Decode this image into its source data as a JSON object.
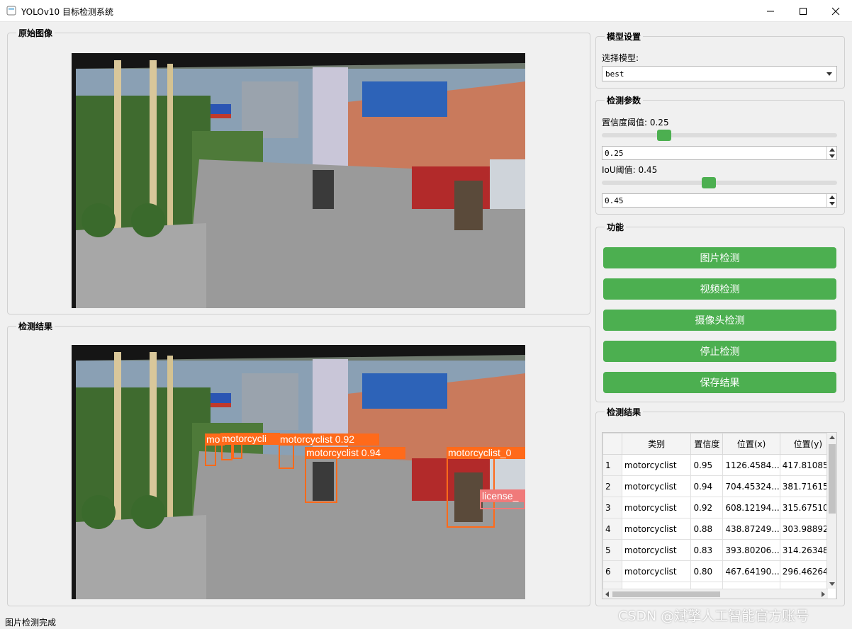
{
  "window": {
    "title": "YOLOv10 目标检测系统"
  },
  "panels": {
    "original_title": "原始图像",
    "result_title": "检测结果"
  },
  "model": {
    "group_title": "模型设置",
    "label": "选择模型:",
    "selected": "best"
  },
  "params": {
    "group_title": "检测参数",
    "conf_label": "置信度阈值: 0.25",
    "conf_value": "0.25",
    "conf_level": 0.25,
    "iou_label": "IoU阈值: 0.45",
    "iou_value": "0.45",
    "iou_level": 0.45
  },
  "functions": {
    "group_title": "功能",
    "buttons": [
      "图片检测",
      "视频检测",
      "摄像头检测",
      "停止检测",
      "保存结果"
    ]
  },
  "detections": {
    "labels": [
      "motorcyclist 0.92",
      "motorcyclist 0.94",
      "motorcyclist_0",
      "license_",
      "mo",
      "motorcycli"
    ]
  },
  "results": {
    "group_title": "检测结果",
    "columns": [
      "",
      "类别",
      "置信度",
      "位置(x)",
      "位置(y)"
    ],
    "rows": [
      [
        "1",
        "motorcyclist",
        "0.95",
        "1126.4584...",
        "417.81085"
      ],
      [
        "2",
        "motorcyclist",
        "0.94",
        "704.45324...",
        "381.71615"
      ],
      [
        "3",
        "motorcyclist",
        "0.92",
        "608.12194...",
        "315.67510"
      ],
      [
        "4",
        "motorcyclist",
        "0.88",
        "438.87249...",
        "303.98892"
      ],
      [
        "5",
        "motorcyclist",
        "0.83",
        "393.80206...",
        "314.26348"
      ],
      [
        "6",
        "motorcyclist",
        "0.80",
        "467.64190...",
        "296.46264"
      ],
      [
        "7",
        "",
        "",
        "",
        ""
      ]
    ]
  },
  "status": {
    "text": "图片检测完成"
  },
  "watermark": "CSDN @斌擎人工智能官方账号",
  "colors": {
    "accent": "#4caf50",
    "box": "#ff6a1a"
  }
}
